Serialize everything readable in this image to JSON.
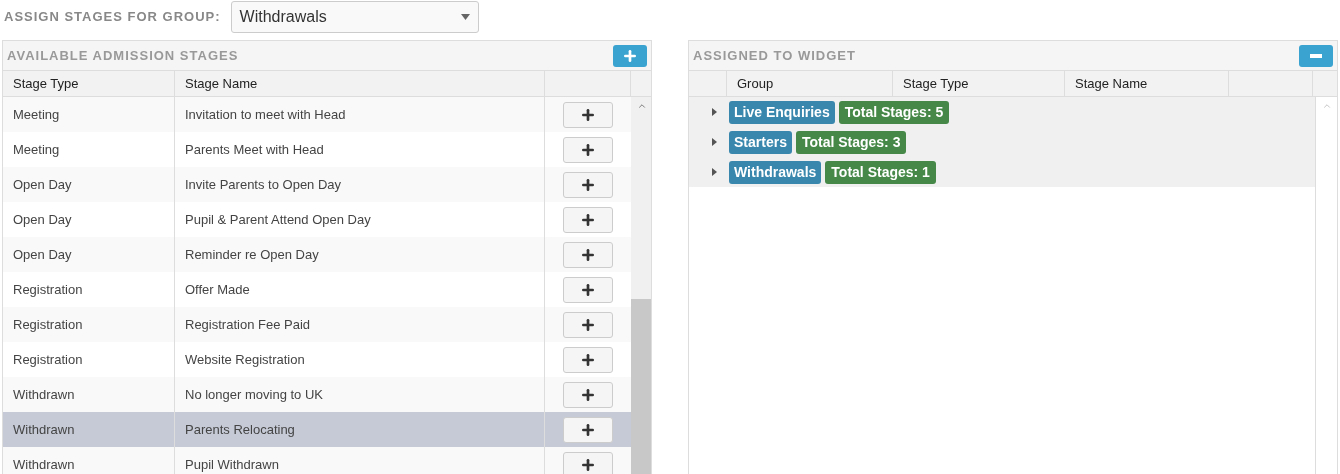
{
  "group_picker": {
    "label": "ASSIGN STAGES FOR GROUP:",
    "value": "Withdrawals"
  },
  "available": {
    "title": "AVAILABLE ADMISSION STAGES",
    "columns": [
      "Stage Type",
      "Stage Name"
    ],
    "rows": [
      {
        "stage_type": "Meeting",
        "stage_name": "Invitation to meet with Head",
        "selected": false
      },
      {
        "stage_type": "Meeting",
        "stage_name": "Parents Meet with Head",
        "selected": false
      },
      {
        "stage_type": "Open Day",
        "stage_name": "Invite Parents to Open Day",
        "selected": false
      },
      {
        "stage_type": "Open Day",
        "stage_name": "Pupil & Parent Attend Open Day",
        "selected": false
      },
      {
        "stage_type": "Open Day",
        "stage_name": "Reminder re Open Day",
        "selected": false
      },
      {
        "stage_type": "Registration",
        "stage_name": "Offer Made",
        "selected": false
      },
      {
        "stage_type": "Registration",
        "stage_name": "Registration Fee Paid",
        "selected": false
      },
      {
        "stage_type": "Registration",
        "stage_name": "Website Registration",
        "selected": false
      },
      {
        "stage_type": "Withdrawn",
        "stage_name": "No longer moving to UK",
        "selected": false
      },
      {
        "stage_type": "Withdrawn",
        "stage_name": "Parents Relocating",
        "selected": true
      },
      {
        "stage_type": "Withdrawn",
        "stage_name": "Pupil Withdrawn",
        "selected": false
      }
    ]
  },
  "assigned": {
    "title": "ASSIGNED TO WIDGET",
    "columns": [
      "Group",
      "Stage Type",
      "Stage Name"
    ],
    "groups": [
      {
        "name": "Live Enquiries",
        "total": "Total Stages: 5",
        "expanded": false
      },
      {
        "name": "Starters",
        "total": "Total Stages: 3",
        "expanded": false
      },
      {
        "name": "Withdrawals",
        "total": "Total Stages: 1",
        "expanded": false
      }
    ]
  }
}
